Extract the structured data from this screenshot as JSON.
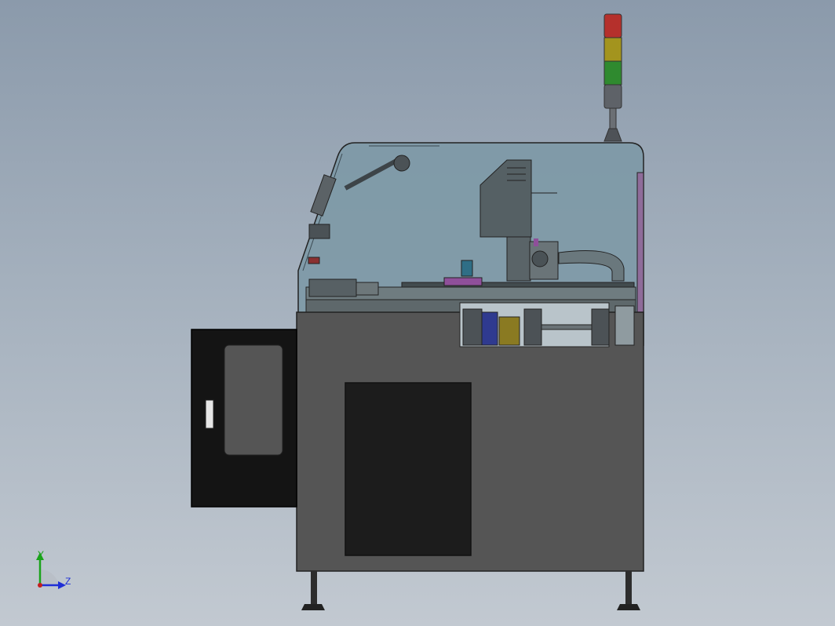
{
  "viewport": {
    "background_top": "#8b9aab",
    "background_bottom": "#c2c9d1"
  },
  "machine": {
    "body_color": "#555555",
    "door_color": "#141414",
    "glass_color": "#7d99a6",
    "tower_lights": [
      "#b5302c",
      "#a3941e",
      "#2f8a2f",
      "#5e6268"
    ]
  },
  "triad": {
    "y_label": "Y",
    "z_label": "Z",
    "y_color": "#1aa31a",
    "z_color": "#1f2fd6",
    "origin_color": "#c41f1f"
  }
}
